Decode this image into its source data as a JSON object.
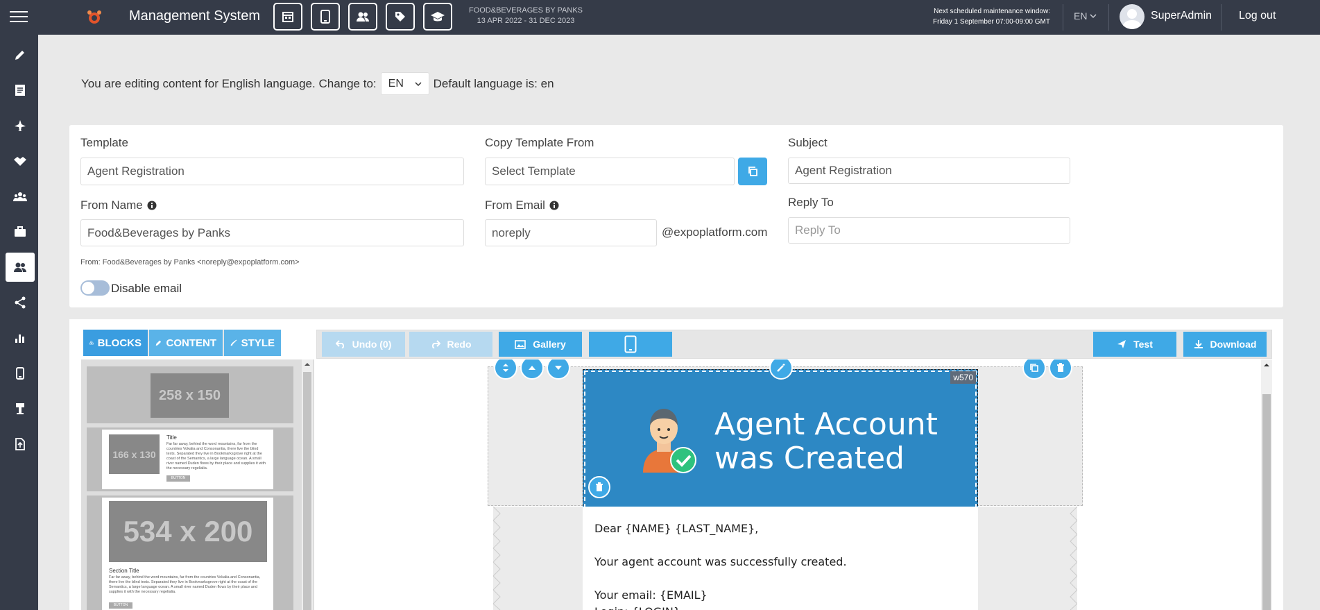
{
  "header": {
    "app_title": "Management System",
    "event_name": "FOOD&BEVERAGES BY PANKS",
    "event_dates": "13 APR 2022 - 31 DEC 2023",
    "maintenance_line1": "Next scheduled maintenance window:",
    "maintenance_line2": "Friday 1 September 07:00-09:00 GMT",
    "language": "EN",
    "username": "SuperAdmin",
    "logout": "Log out",
    "icons": [
      "calendar-icon",
      "mobile-icon",
      "users-icon",
      "tag-icon",
      "graduation-cap-icon"
    ]
  },
  "sidebar": {
    "items": [
      "edit-icon",
      "document-icon",
      "plane-icon",
      "handshake-icon",
      "team-icon",
      "briefcase-icon",
      "user-group-icon",
      "share-icon",
      "bar-chart-icon",
      "mobile-icon",
      "kiosk-icon",
      "file-upload-icon"
    ],
    "active_index": 6
  },
  "language_bar": {
    "prefix": "You are editing content for English language. Change to:",
    "selected": "EN",
    "suffix": "Default language is: en"
  },
  "form": {
    "template_label": "Template",
    "template_value": "Agent Registration",
    "copy_label": "Copy Template From",
    "copy_placeholder": "Select Template",
    "subject_label": "Subject",
    "subject_value": "Agent Registration",
    "from_name_label": "From Name",
    "from_name_value": "Food&Beverages by Panks",
    "from_email_label": "From Email",
    "from_email_value": "noreply",
    "domain": "@expoplatform.com",
    "reply_to_label": "Reply To",
    "reply_to_placeholder": "Reply To",
    "from_line": "From: Food&Beverages by Panks <noreply@expoplatform.com>",
    "disable_email_label": "Disable email"
  },
  "editor": {
    "tabs": [
      "BLOCKS",
      "CONTENT",
      "STYLE"
    ],
    "undo": "Undo (0)",
    "redo": "Redo",
    "gallery": "Gallery",
    "test": "Test",
    "download": "Download",
    "thumbs": {
      "ph1": "258 x 150",
      "ph2": "166 x 130",
      "ph3": "534 x 200",
      "title": "Title",
      "section_title": "Section Title",
      "button": "BUTTON",
      "lorem": "Far far away, behind the word mountains, far from the countries Vokalia and Consonantia, there live the blind texts. Separated they live in Bookmarksgrove right at the coast of the Semantics, a large language ocean. A small river named Duden flows by their place and supplies it with the necessary regelialia."
    },
    "banner_line1": "Agent Account",
    "banner_line2": "was Created",
    "width_badge": "w570",
    "body_lines": [
      "Dear {NAME} {LAST_NAME},",
      "",
      "Your agent account was successfully created.",
      "",
      "Your email: {EMAIL}",
      "Login: {LOGIN}"
    ]
  },
  "colors": {
    "topbar": "#353b48",
    "accent": "#3fa9e6",
    "banner": "#2d88c4"
  }
}
